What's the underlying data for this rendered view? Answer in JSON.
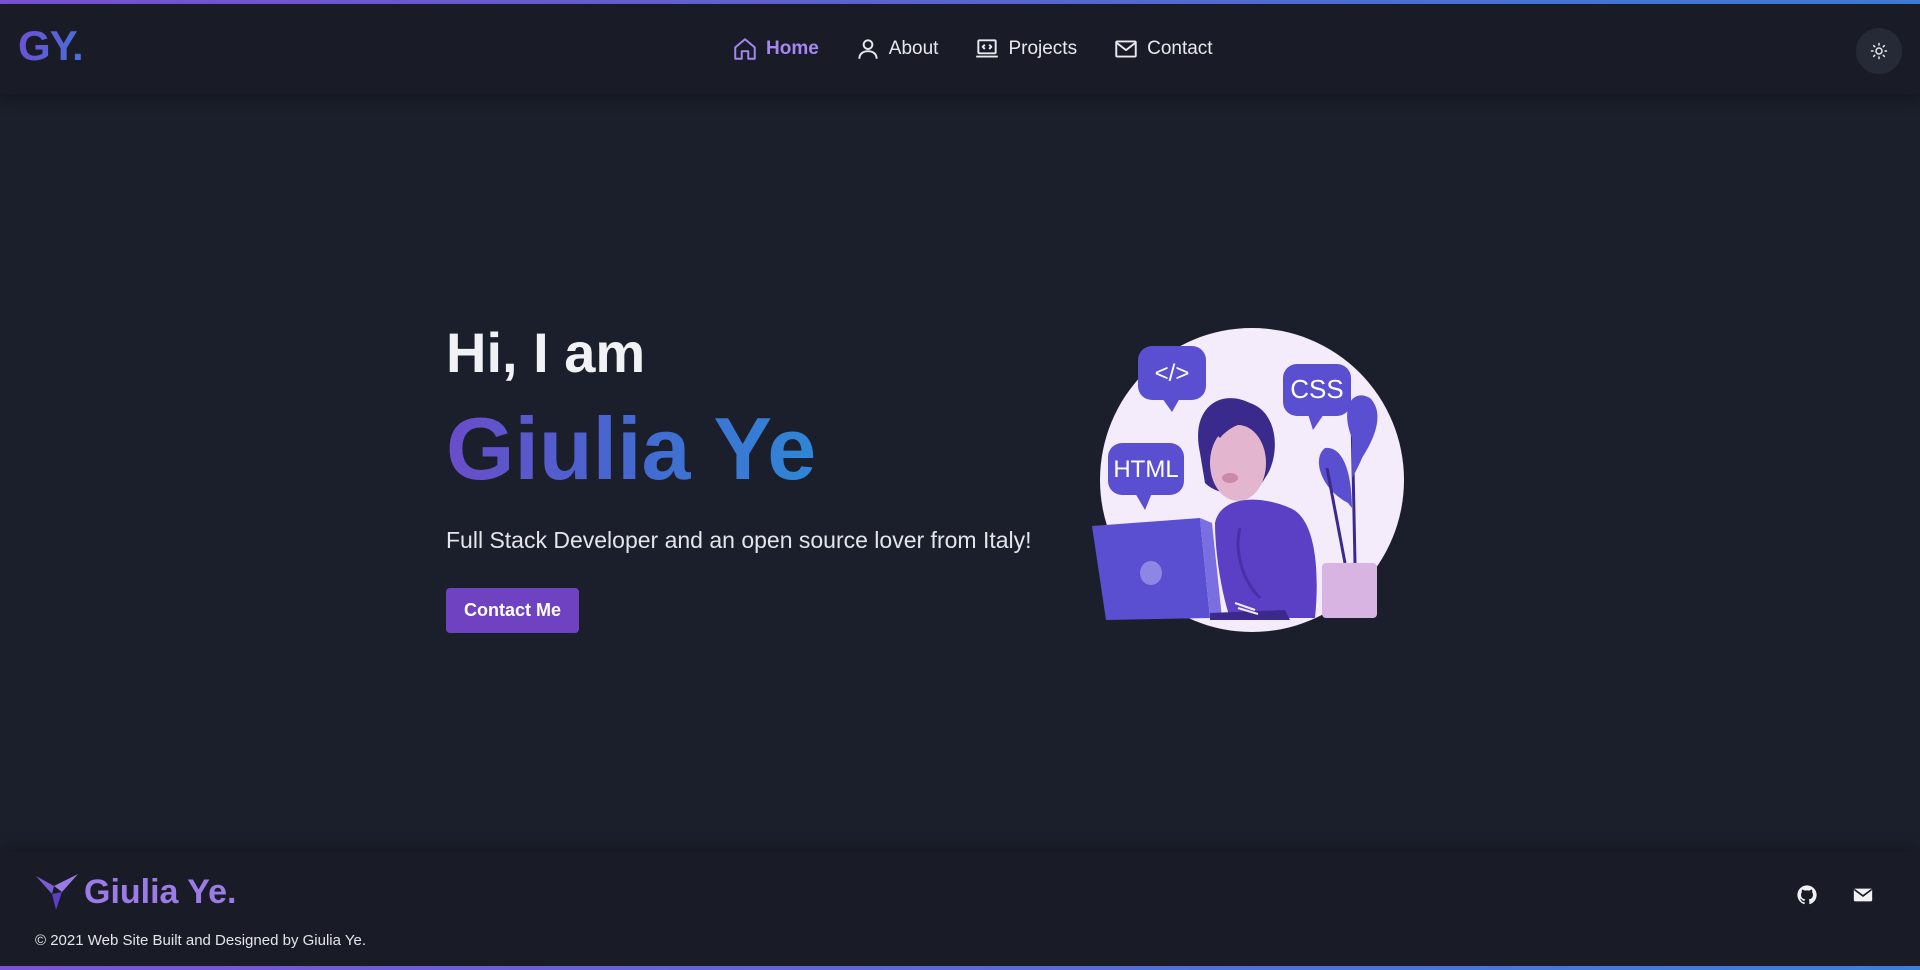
{
  "header": {
    "logo": "GY.",
    "nav": [
      {
        "label": "Home",
        "icon": "home-icon",
        "active": true
      },
      {
        "label": "About",
        "icon": "user-icon",
        "active": false
      },
      {
        "label": "Projects",
        "icon": "laptop-code-icon",
        "active": false
      },
      {
        "label": "Contact",
        "icon": "mail-icon",
        "active": false
      }
    ],
    "theme_toggle_icon": "sun-icon"
  },
  "hero": {
    "greeting": "Hi, I am",
    "name": "Giulia Ye",
    "tagline": "Full Stack Developer and an open source lover from Italy!",
    "cta_label": "Contact Me",
    "illustration": {
      "bubble_code": "</>",
      "bubble_css": "CSS",
      "bubble_html": "HTML"
    }
  },
  "footer": {
    "brand_name": "Giulia Ye.",
    "copyright": "© 2021 Web Site Built and Designed by Giulia Ye.",
    "icons": [
      "github-icon",
      "envelope-icon"
    ]
  },
  "colors": {
    "accent": "#6f42c1",
    "accent_light": "#a487f0",
    "gradient_start": "#6b4cc9",
    "gradient_end": "#2f86d6",
    "background": "#1b1f2b"
  }
}
